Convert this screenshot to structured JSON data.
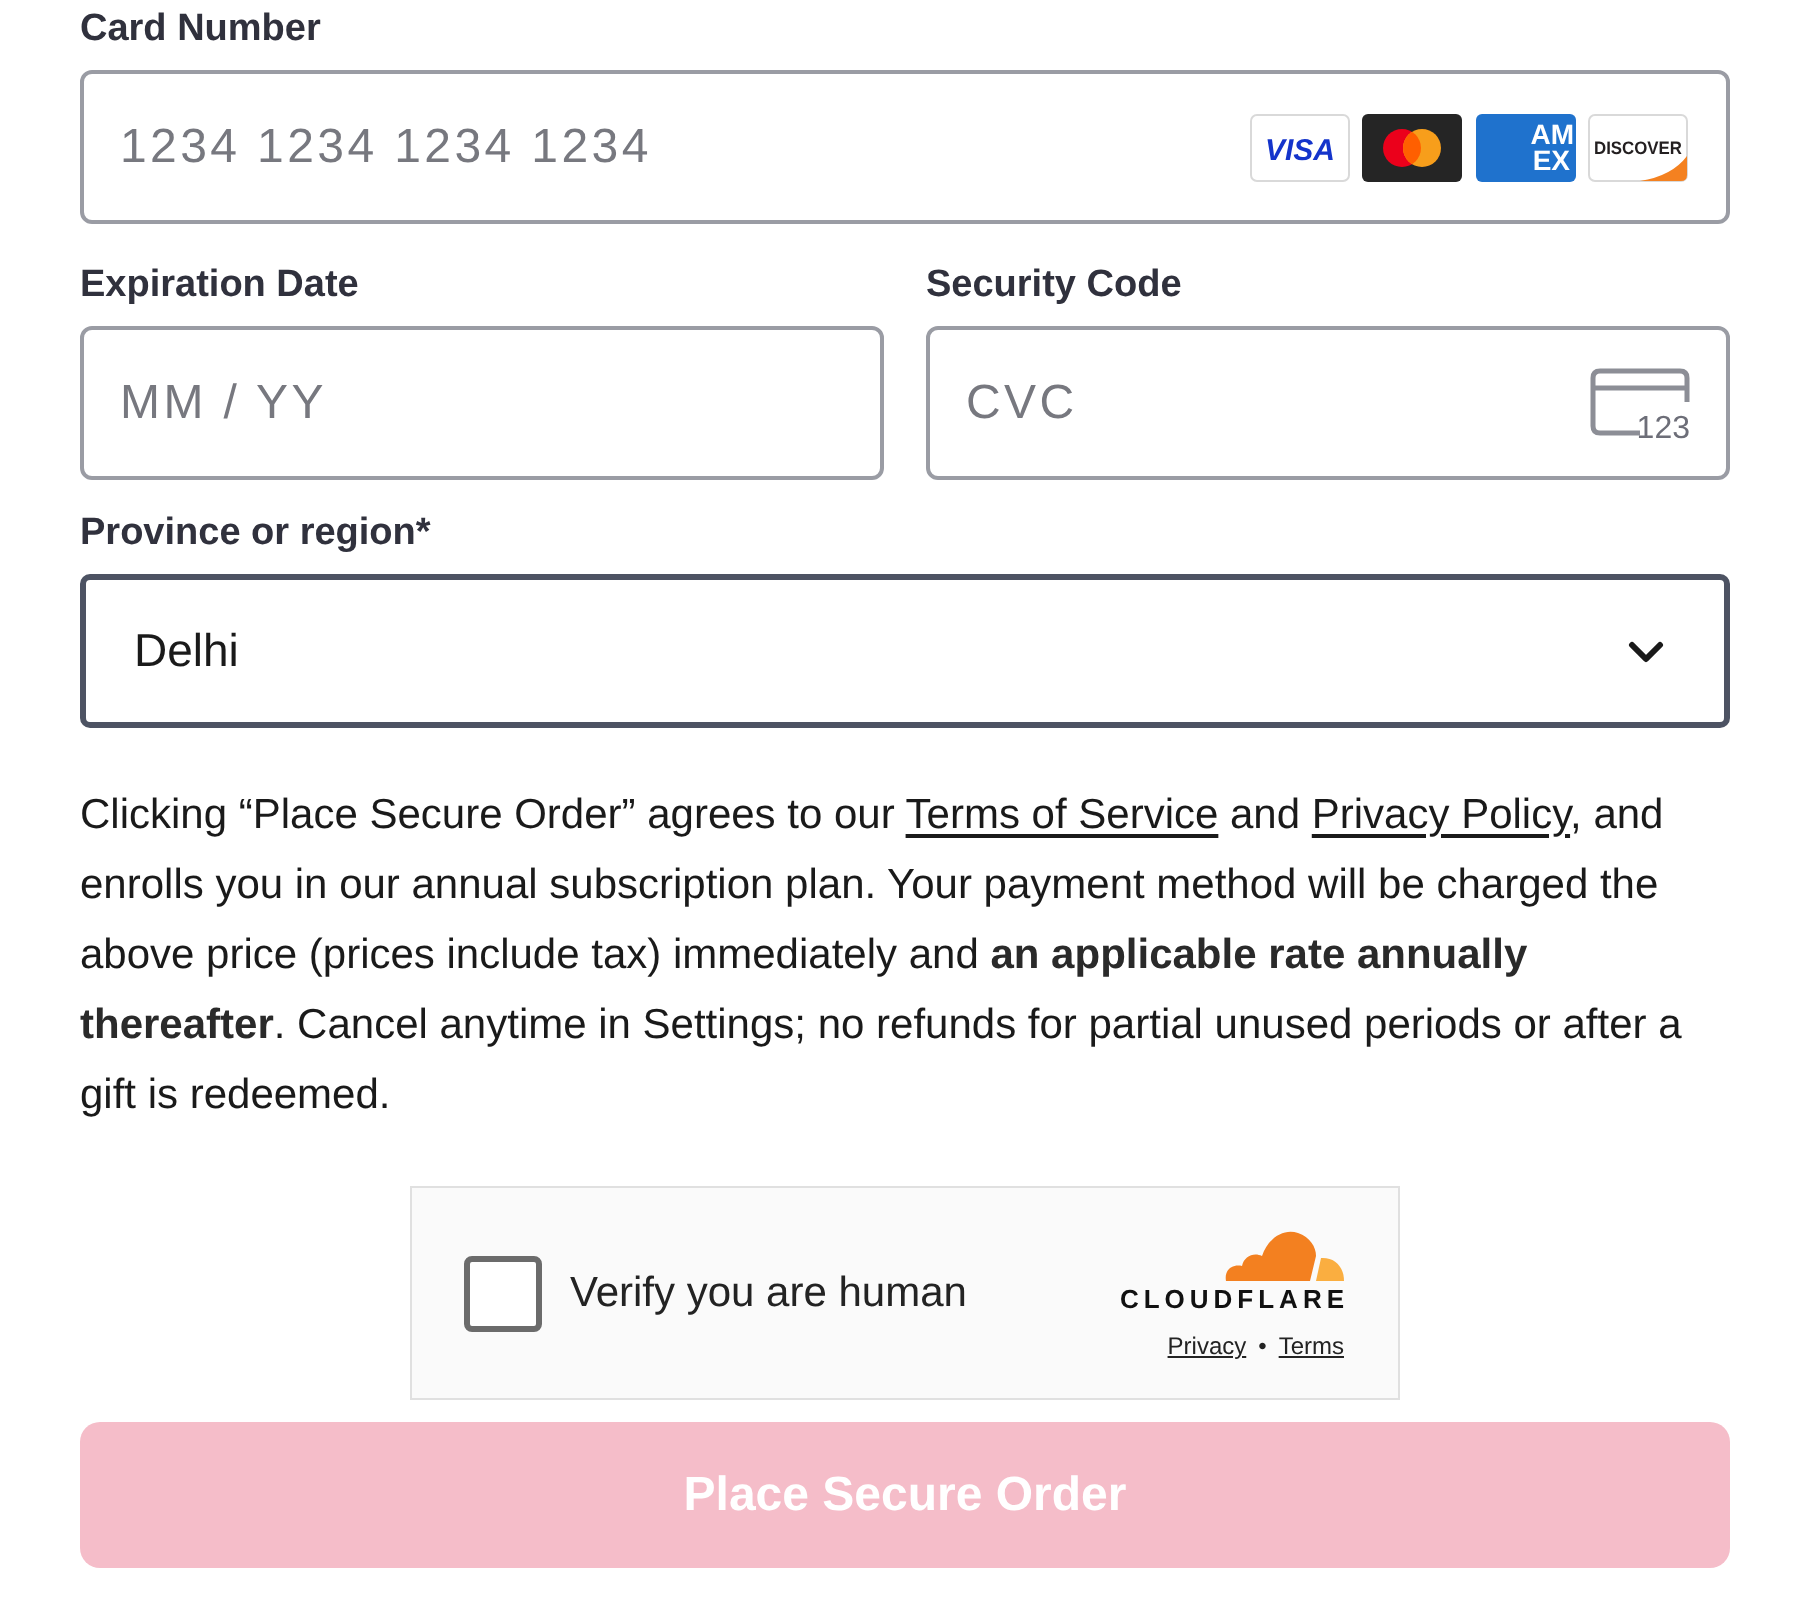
{
  "card_number": {
    "label": "Card Number",
    "placeholder": "1234 1234 1234 1234",
    "brands": [
      {
        "kind": "visa",
        "text": "VISA"
      },
      {
        "kind": "mastercard"
      },
      {
        "kind": "amex",
        "lines": [
          "AM",
          "EX"
        ]
      },
      {
        "kind": "discover",
        "text": "DISCOVER"
      }
    ]
  },
  "expiration": {
    "label": "Expiration Date",
    "placeholder": "MM / YY"
  },
  "security_code": {
    "label": "Security Code",
    "placeholder": "CVC",
    "hint": "123"
  },
  "region": {
    "label": "Province or region*",
    "value": "Delhi"
  },
  "terms": {
    "parts": [
      {
        "kind": "text",
        "text": "Clicking “Place Secure Order” agrees to our "
      },
      {
        "kind": "link",
        "text": "Terms of Service"
      },
      {
        "kind": "text",
        "text": " and "
      },
      {
        "kind": "link",
        "text": "Privacy Policy"
      },
      {
        "kind": "text",
        "text": ", and enrolls you in our annual subscription plan. Your payment method will be charged the above price (prices include tax) immediately and **an applicable rate annually thereafter**. Cancel anytime in Settings; no refunds for partial unused periods or after a gift is redeemed."
      }
    ]
  },
  "captcha": {
    "label": "Verify you are human",
    "checked": false,
    "brand": "CLOUDFLARE",
    "links": [
      "Privacy",
      "Terms"
    ],
    "separator": "•"
  },
  "submit": {
    "label": "Place Secure Order",
    "disabled": true
  }
}
